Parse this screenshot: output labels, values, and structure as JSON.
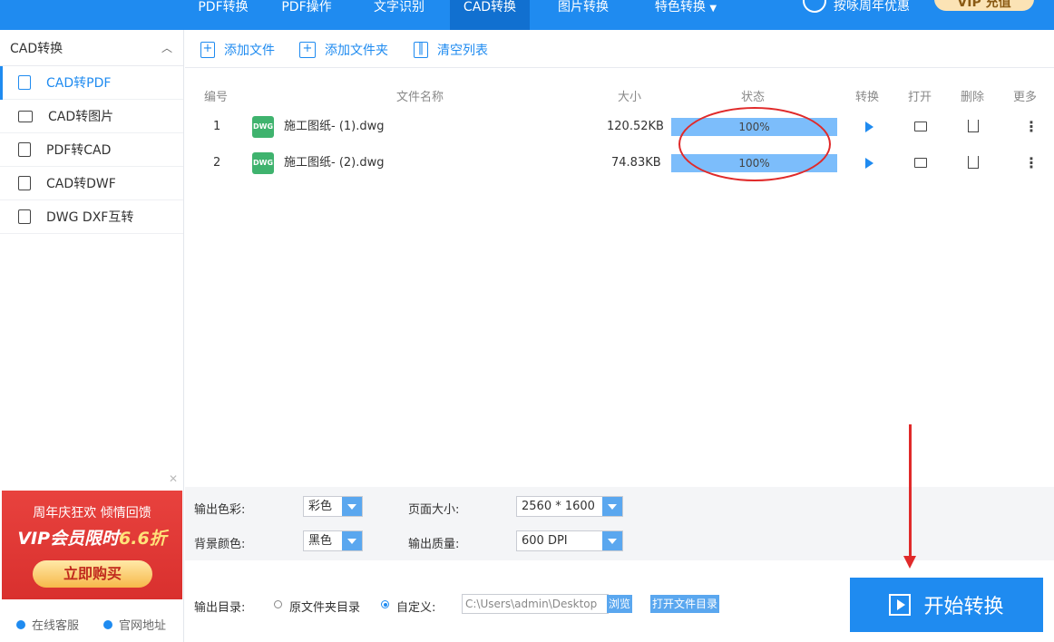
{
  "nav": {
    "items": [
      "PDF转换",
      "PDF操作",
      "文字识别",
      "CAD转换",
      "图片转换",
      "特色转换"
    ],
    "active_index": 3,
    "user_text": "按咏周年优惠",
    "vip_label": "VIP 充值"
  },
  "sidebar": {
    "section_title": "CAD转换",
    "items": [
      {
        "label": "CAD转PDF",
        "icon": "pdf-file-icon"
      },
      {
        "label": "CAD转图片",
        "icon": "image-icon"
      },
      {
        "label": "PDF转CAD",
        "icon": "file-convert-icon"
      },
      {
        "label": "CAD转DWF",
        "icon": "file-icon"
      },
      {
        "label": "DWG DXF互转",
        "icon": "file-text-icon"
      }
    ],
    "active_index": 0,
    "ad": {
      "line1": "周年庆狂欢 倾情回馈",
      "line2_prefix": "VIP会员限时",
      "line2_highlight": "6.6折",
      "button": "立即购买"
    },
    "footer": {
      "service": "在线客服",
      "website": "官网地址"
    }
  },
  "toolbar": {
    "add_file": "添加文件",
    "add_folder": "添加文件夹",
    "clear_list": "清空列表"
  },
  "table": {
    "headers": [
      "编号",
      "文件名称",
      "大小",
      "状态",
      "转换",
      "打开",
      "删除",
      "更多"
    ],
    "rows": [
      {
        "index": "1",
        "badge": "DWG",
        "name": "施工图纸- (1).dwg",
        "size": "120.52KB",
        "status": "100%"
      },
      {
        "index": "2",
        "badge": "DWG",
        "name": "施工图纸- (2).dwg",
        "size": "74.83KB",
        "status": "100%"
      }
    ]
  },
  "settings": {
    "color_label": "输出色彩:",
    "color_value": "彩色",
    "bg_label": "背景颜色:",
    "bg_value": "黑色",
    "page_label": "页面大小:",
    "page_value": "2560 * 1600",
    "quality_label": "输出质量:",
    "quality_value": "600 DPI"
  },
  "output": {
    "label": "输出目录:",
    "option_original": "原文件夹目录",
    "option_custom": "自定义:",
    "selected": "custom",
    "path": "C:\\Users\\admin\\Desktop",
    "browse": "浏览",
    "open_folder": "打开文件目录",
    "start": "开始转换"
  },
  "colors": {
    "accent": "#1f8bf0",
    "annotation": "#e02a2a",
    "progress": "#7cbdfb"
  }
}
